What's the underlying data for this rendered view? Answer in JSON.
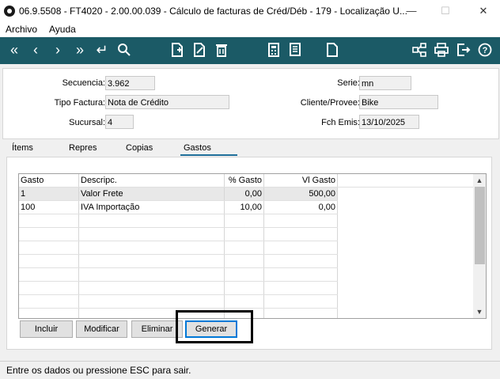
{
  "window": {
    "title": "06.9.5508 - FT4020 - 2.00.00.039 - Cálculo de facturas de Créd/Déb - 179 - Localização U...",
    "minimize": "—",
    "maximize": "☐",
    "close": "✕"
  },
  "menu": {
    "archivo": "Archivo",
    "ayuda": "Ayuda"
  },
  "header": {
    "secuencia_label": "Secuencia:",
    "secuencia_value": "3.962",
    "tipo_label": "Tipo Factura:",
    "tipo_value": "Nota de Crédito",
    "sucursal_label": "Sucursal:",
    "sucursal_value": "4",
    "serie_label": "Serie:",
    "serie_value": "mn",
    "cliente_label": "Cliente/Provee:",
    "cliente_value": "Bike",
    "fecha_label": "Fch Emis:",
    "fecha_value": "13/10/2025"
  },
  "tabs": [
    "Ítems",
    "Repres",
    "Copias",
    "Gastos"
  ],
  "active_tab": "Gastos",
  "grid": {
    "headers": [
      "Gasto",
      "Descripc.",
      "% Gasto",
      "Vl Gasto"
    ],
    "rows": [
      [
        "1",
        "Valor Frete",
        "0,00",
        "500,00"
      ],
      [
        "100",
        "IVA Importação",
        "10,00",
        "0,00"
      ]
    ]
  },
  "buttons": {
    "incluir": "Incluir",
    "modificar": "Modificar",
    "eliminar": "Eliminar",
    "generar": "Generar"
  },
  "status": "Entre os dados ou pressione ESC para sair.",
  "colors": {
    "toolbar": "#1b5a66",
    "tab_active": "#1f6f9a"
  }
}
